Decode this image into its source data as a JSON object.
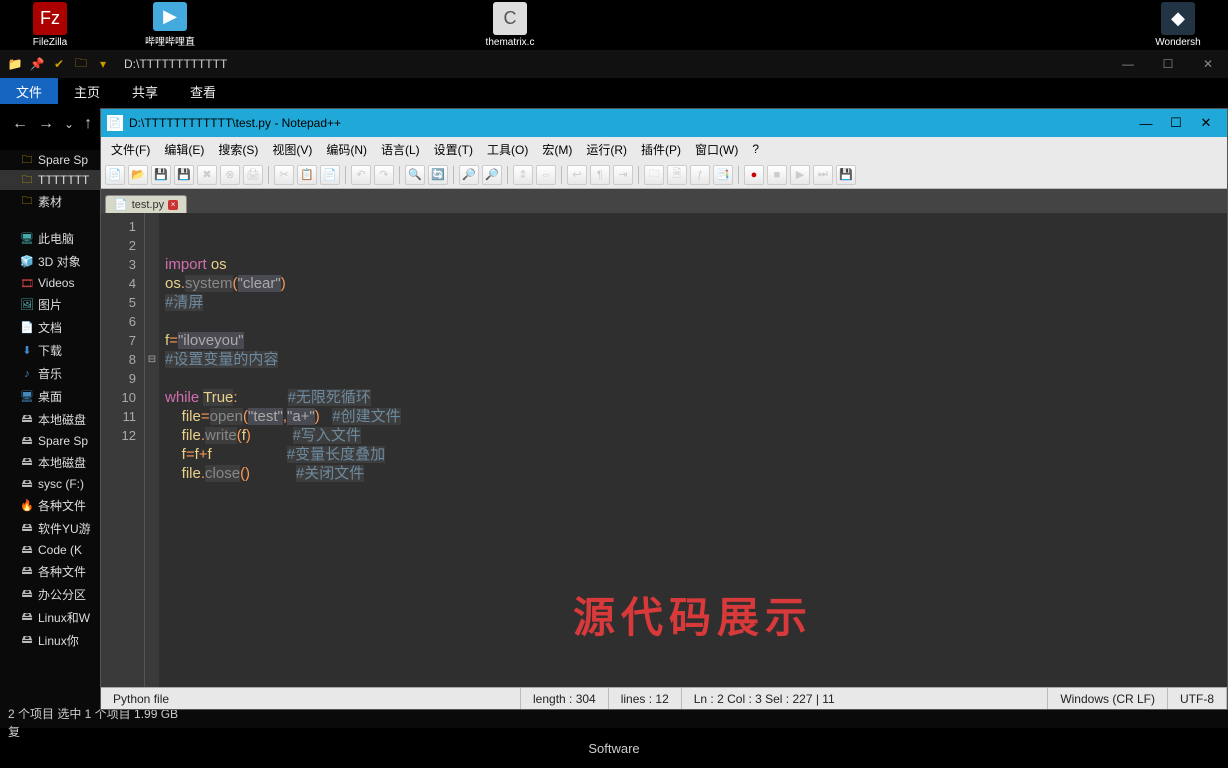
{
  "desktop": {
    "icons": [
      "FileZilla",
      "哔哩哔哩直",
      "thematrix.c",
      "Wondersh"
    ]
  },
  "explorer": {
    "path": "D:\\TTTTTTTTTTTT",
    "tabs": [
      "文件",
      "主页",
      "共享",
      "查看"
    ],
    "nav_symbols": {
      "back": "←",
      "fwd": "→",
      "up": "↑"
    },
    "tree": [
      {
        "icon": "folder",
        "label": "Spare Sp"
      },
      {
        "icon": "folder",
        "label": "TTTTTTT",
        "sel": true
      },
      {
        "icon": "folder",
        "label": "素材"
      },
      {
        "icon": "pc",
        "label": "此电脑"
      },
      {
        "icon": "obj",
        "label": "3D 对象"
      },
      {
        "icon": "vid",
        "label": "Videos"
      },
      {
        "icon": "pic",
        "label": "图片"
      },
      {
        "icon": "doc",
        "label": "文档"
      },
      {
        "icon": "dl",
        "label": "下载"
      },
      {
        "icon": "mus",
        "label": "音乐"
      },
      {
        "icon": "desk",
        "label": "桌面"
      },
      {
        "icon": "disk",
        "label": "本地磁盘"
      },
      {
        "icon": "disk",
        "label": "Spare Sp"
      },
      {
        "icon": "disk",
        "label": "本地磁盘"
      },
      {
        "icon": "disk",
        "label": "sysc (F:)"
      },
      {
        "icon": "fire",
        "label": "各种文件"
      },
      {
        "icon": "disk",
        "label": "软件YU游"
      },
      {
        "icon": "disk",
        "label": "Code (K"
      },
      {
        "icon": "disk",
        "label": "各种文件"
      },
      {
        "icon": "disk",
        "label": "办公分区"
      },
      {
        "icon": "disk",
        "label": "Linux和W"
      },
      {
        "icon": "disk",
        "label": "Linux你"
      }
    ],
    "status": "2 个项目    选中 1 个项目  1.99 GB",
    "status2": "复"
  },
  "taskbar": {
    "label": "Software"
  },
  "npp": {
    "title": "D:\\TTTTTTTTTTTT\\test.py - Notepad++",
    "menu": [
      "文件(F)",
      "编辑(E)",
      "搜索(S)",
      "视图(V)",
      "编码(N)",
      "语言(L)",
      "设置(T)",
      "工具(O)",
      "宏(M)",
      "运行(R)",
      "插件(P)",
      "窗口(W)",
      "?"
    ],
    "tab": "test.py",
    "gutter": [
      "1",
      "2",
      "3",
      "4",
      "5",
      "6",
      "7",
      "8",
      "9",
      "10",
      "11",
      "12"
    ],
    "code_lines": [
      [
        {
          "t": "import ",
          "c": "kw"
        },
        {
          "t": "os",
          "c": "mod"
        }
      ],
      [
        {
          "t": "os",
          "c": "mod"
        },
        {
          "t": ".",
          "c": "op"
        },
        {
          "t": "system",
          "c": "fn hl"
        },
        {
          "t": "(",
          "c": "op"
        },
        {
          "t": "\"clear\"",
          "c": "str"
        },
        {
          "t": ")",
          "c": "op"
        }
      ],
      [
        {
          "t": "#清屏",
          "c": "com"
        }
      ],
      [],
      [
        {
          "t": "f",
          "c": "mod"
        },
        {
          "t": "=",
          "c": "op"
        },
        {
          "t": "\"iloveyou\"",
          "c": "str"
        }
      ],
      [
        {
          "t": "#设置变量的内容",
          "c": "com"
        }
      ],
      [],
      [
        {
          "t": "while ",
          "c": "kw"
        },
        {
          "t": "True",
          "c": "mod hl"
        },
        {
          "t": ":",
          "c": "op"
        },
        {
          "t": "            ",
          "c": ""
        },
        {
          "t": "#无限死循环",
          "c": "com"
        }
      ],
      [
        {
          "t": "    ",
          "c": ""
        },
        {
          "t": "file",
          "c": "mod"
        },
        {
          "t": "=",
          "c": "op"
        },
        {
          "t": "open",
          "c": "fn hl"
        },
        {
          "t": "(",
          "c": "op"
        },
        {
          "t": "\"test\"",
          "c": "str"
        },
        {
          "t": ",",
          "c": "op"
        },
        {
          "t": "\"a+\"",
          "c": "str"
        },
        {
          "t": ")",
          "c": "op"
        },
        {
          "t": "   ",
          "c": ""
        },
        {
          "t": "#创建文件",
          "c": "com"
        }
      ],
      [
        {
          "t": "    ",
          "c": ""
        },
        {
          "t": "file",
          "c": "mod"
        },
        {
          "t": ".",
          "c": "op"
        },
        {
          "t": "write",
          "c": "fn hl"
        },
        {
          "t": "(",
          "c": "op"
        },
        {
          "t": "f",
          "c": "mod"
        },
        {
          "t": ")",
          "c": "op"
        },
        {
          "t": "          ",
          "c": ""
        },
        {
          "t": "#写入文件",
          "c": "com"
        }
      ],
      [
        {
          "t": "    ",
          "c": ""
        },
        {
          "t": "f",
          "c": "mod"
        },
        {
          "t": "=",
          "c": "op"
        },
        {
          "t": "f",
          "c": "mod"
        },
        {
          "t": "+",
          "c": "op"
        },
        {
          "t": "f",
          "c": "mod"
        },
        {
          "t": "                  ",
          "c": ""
        },
        {
          "t": "#变量长度叠加",
          "c": "com"
        }
      ],
      [
        {
          "t": "    ",
          "c": ""
        },
        {
          "t": "file",
          "c": "mod"
        },
        {
          "t": ".",
          "c": "op"
        },
        {
          "t": "close",
          "c": "fn hl"
        },
        {
          "t": "()",
          "c": "op"
        },
        {
          "t": "           ",
          "c": ""
        },
        {
          "t": "#关闭文件",
          "c": "com"
        }
      ]
    ],
    "watermark": "源代码展示",
    "status": {
      "filetype": "Python file",
      "length": "length : 304",
      "lines": "lines : 12",
      "pos": "Ln : 2    Col : 3    Sel : 227 | 11",
      "eol": "Windows (CR LF)",
      "enc": "UTF-8"
    }
  }
}
